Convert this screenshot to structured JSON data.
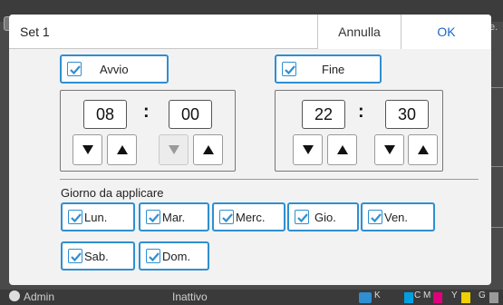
{
  "background": {
    "right_text": "e.",
    "status_user": "Admin",
    "status_state": "Inattivo",
    "ink_labels": [
      "K",
      "C",
      "M",
      "Y",
      "G"
    ],
    "ink_colors": [
      "#2a2a2a",
      "#00a0e0",
      "#e0007a",
      "#f0d000",
      "#808080"
    ]
  },
  "dialog": {
    "title": "Set 1",
    "cancel_label": "Annulla",
    "ok_label": "OK",
    "start": {
      "label": "Avvio",
      "checked": true,
      "hour": "08",
      "minute": "00",
      "minute_down_enabled": false
    },
    "end": {
      "label": "Fine",
      "checked": true,
      "hour": "22",
      "minute": "30"
    },
    "time_separator": ":",
    "days_label": "Giorno da applicare",
    "days": [
      {
        "label": "Lun.",
        "checked": true
      },
      {
        "label": "Mar.",
        "checked": true
      },
      {
        "label": "Merc.",
        "checked": true
      },
      {
        "label": "Gio.",
        "checked": true
      },
      {
        "label": "Ven.",
        "checked": true
      },
      {
        "label": "Sab.",
        "checked": true
      },
      {
        "label": "Dom.",
        "checked": true
      }
    ],
    "accent_color": "#2f8fd0",
    "ok_color": "#1a66c8"
  }
}
